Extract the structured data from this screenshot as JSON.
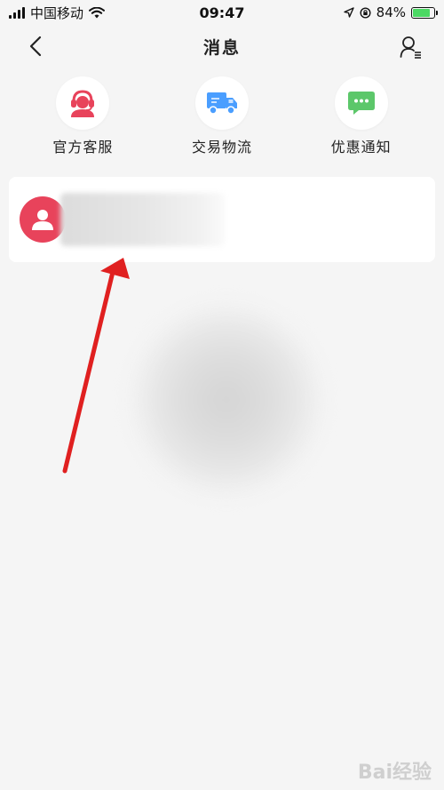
{
  "status_bar": {
    "carrier": "中国移动",
    "time": "09:47",
    "battery": "84%",
    "battery_level": 0.84
  },
  "nav": {
    "title": "消息"
  },
  "shortcuts": [
    {
      "label": "官方客服",
      "icon": "customer-service-icon",
      "color": "#e8435b"
    },
    {
      "label": "交易物流",
      "icon": "delivery-truck-icon",
      "color": "#4a9eff"
    },
    {
      "label": "优惠通知",
      "icon": "chat-bubble-icon",
      "color": "#5cc76a"
    }
  ],
  "colors": {
    "accent": "#e8435b",
    "annotation_arrow": "#e02020",
    "background": "#f5f5f5"
  },
  "watermark": {
    "text": "Bai经验"
  }
}
